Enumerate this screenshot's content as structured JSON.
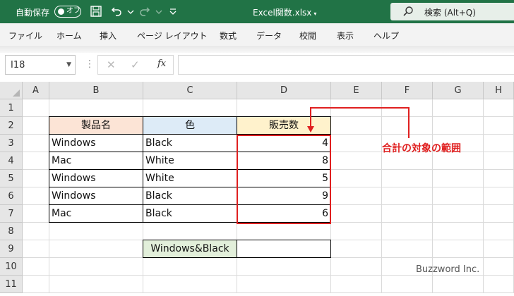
{
  "titlebar": {
    "autosave_label": "自動保存",
    "autosave_state": "オフ",
    "filename": "Excel関数.xlsx",
    "search_text": "検索 (Alt+Q)"
  },
  "menu": [
    "ファイル",
    "ホーム",
    "挿入",
    "ページ レイアウト",
    "数式",
    "データ",
    "校閲",
    "表示",
    "ヘルプ"
  ],
  "formula_bar": {
    "name_box": "I18",
    "formula": ""
  },
  "columns": [
    "A",
    "B",
    "C",
    "D",
    "E",
    "F",
    "G",
    "H"
  ],
  "rows": [
    "1",
    "2",
    "3",
    "4",
    "5",
    "6",
    "7",
    "8",
    "9",
    "10",
    "11"
  ],
  "cells": {
    "B2": "製品名",
    "C2": "色",
    "D2": "販売数",
    "B3": "Windows",
    "C3": "Black",
    "D3": "4",
    "B4": "Mac",
    "C4": "White",
    "D4": "8",
    "B5": "Windows",
    "C5": "White",
    "D5": "5",
    "B6": "Windows",
    "C6": "Black",
    "D6": "9",
    "B7": "Mac",
    "C7": "Black",
    "D7": "6",
    "C9": "Windows&Black",
    "D9": ""
  },
  "annotation": "合計の対象の範囲",
  "watermark": "Buzzword Inc.",
  "colors": {
    "excel_green": "#217346",
    "header_orange": "#fce4d6",
    "header_blue": "#ddebf7",
    "header_yellow": "#fff2cc",
    "label_green": "#e2efda",
    "annotation_red": "#e02020"
  }
}
